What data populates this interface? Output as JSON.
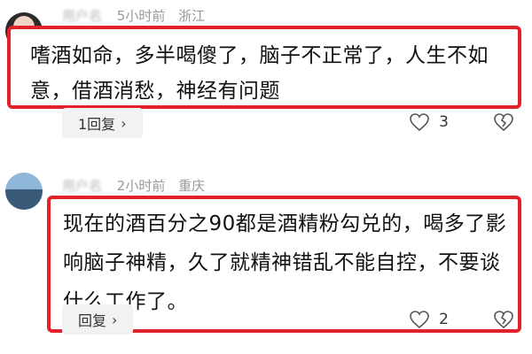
{
  "comments": [
    {
      "meta": {
        "name": "用户名",
        "time": "5小时前",
        "location": "浙江"
      },
      "text": "嗜酒如命，多半喝傻了，脑子不正常了，人生不如意，借酒消愁，神经有问题",
      "reply_label": "1回复",
      "likes": "3"
    },
    {
      "meta": {
        "name": "用户名",
        "time": "2小时前",
        "location": "重庆"
      },
      "text": "现在的酒百分之90都是酒精粉勾兑的，喝多了影响脑子神精，久了就精神错乱不能自控，不要谈什么工作了。",
      "reply_label": "回复",
      "likes": "2"
    }
  ],
  "icons": {
    "like": "heart-outline-icon",
    "dislike": "broken-heart-icon",
    "more": "chevron-right-icon"
  },
  "colors": {
    "highlight": "#e3212b",
    "reply_bg": "#f2f2f2"
  }
}
